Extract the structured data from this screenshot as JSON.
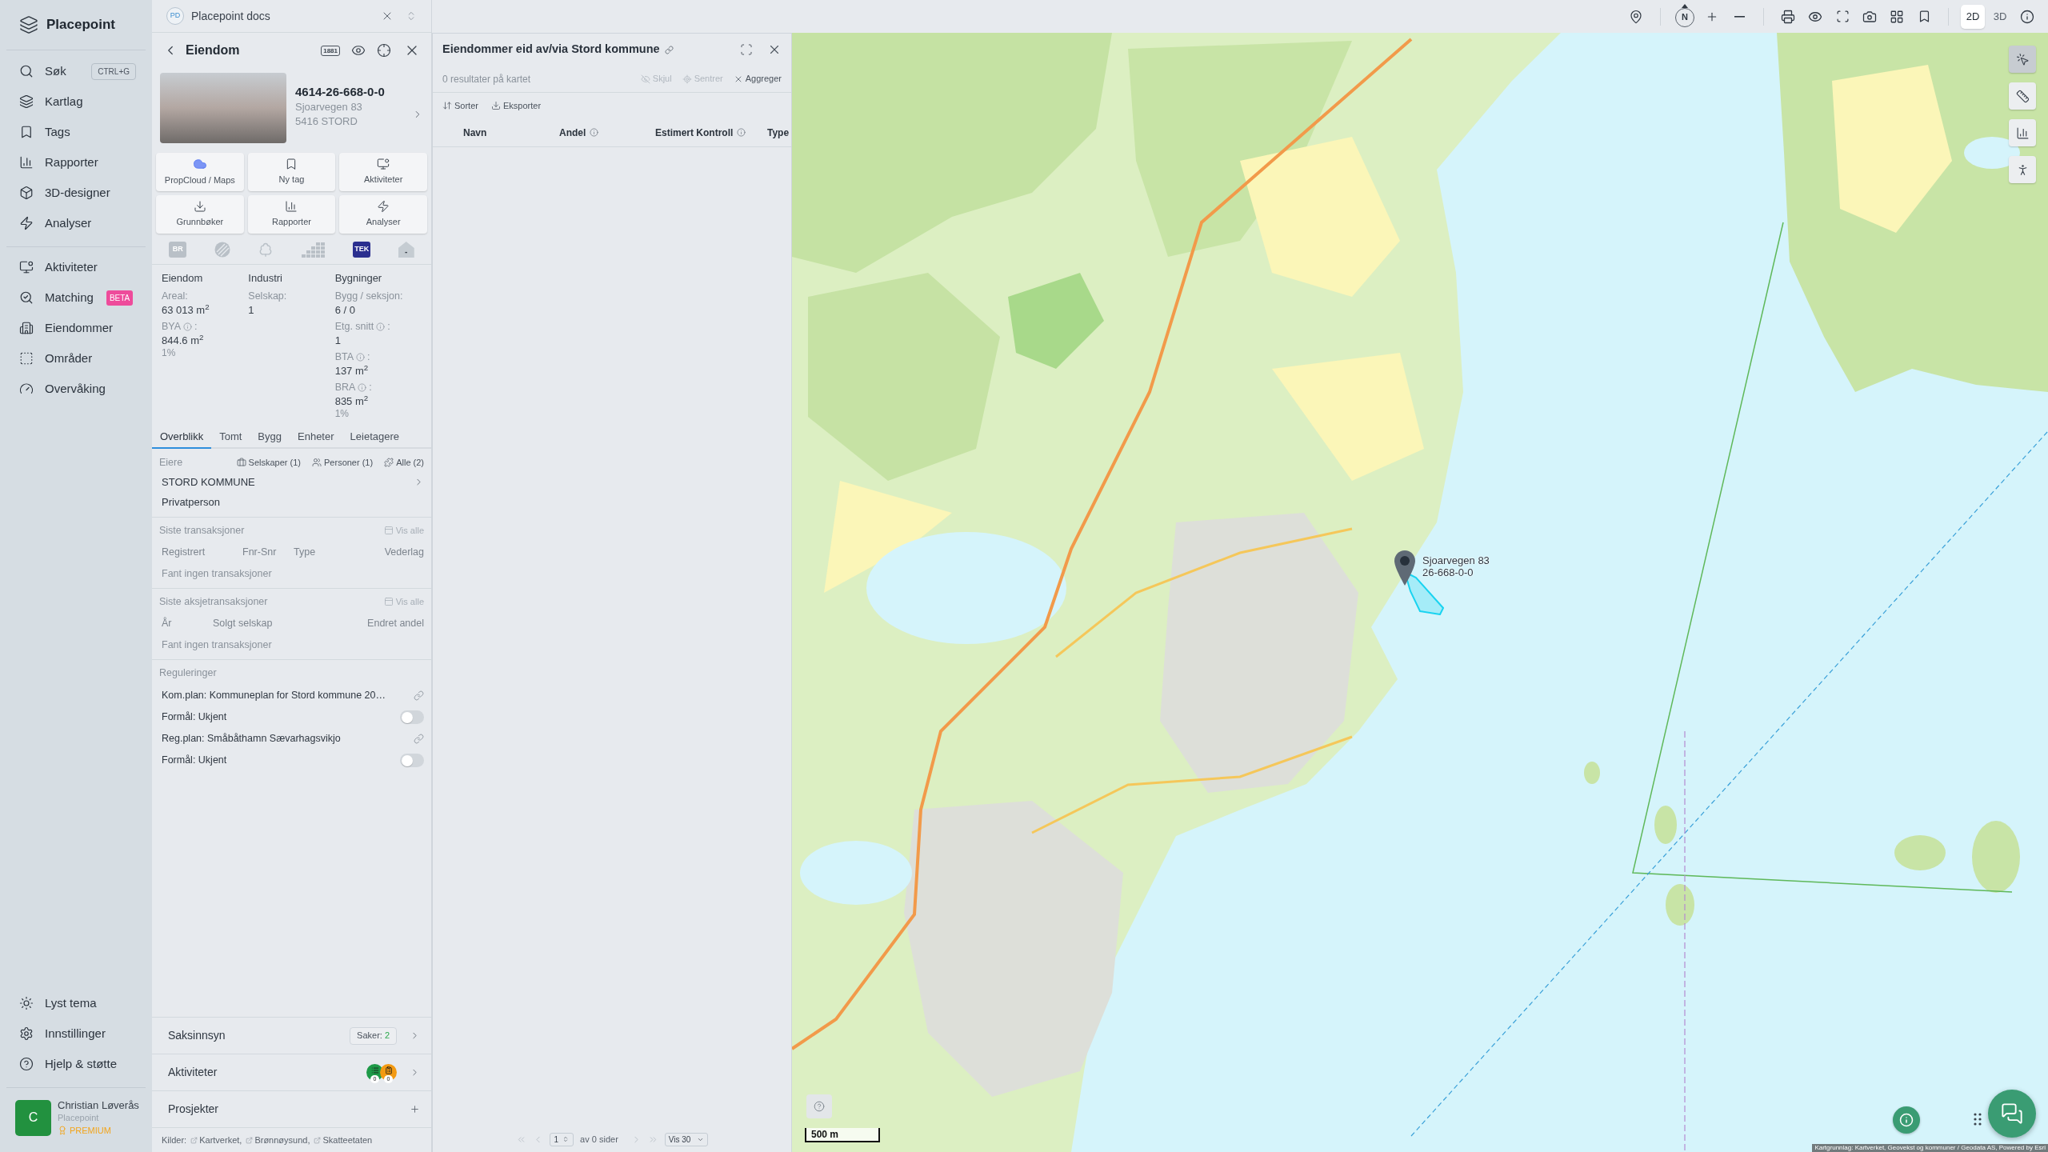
{
  "sidebar": {
    "brand": "Placepoint",
    "items": [
      {
        "label": "Søk",
        "shortcut": "CTRL+G"
      },
      {
        "label": "Kartlag"
      },
      {
        "label": "Tags"
      },
      {
        "label": "Rapporter"
      },
      {
        "label": "3D-designer"
      },
      {
        "label": "Analyser"
      }
    ],
    "items_2": [
      {
        "label": "Aktiviteter"
      },
      {
        "label": "Matching",
        "badge": "BETA"
      },
      {
        "label": "Eiendommer"
      },
      {
        "label": "Områder"
      },
      {
        "label": "Overvåking"
      }
    ],
    "footer_items": [
      {
        "label": "Lyst tema"
      },
      {
        "label": "Innstillinger"
      },
      {
        "label": "Hjelp & støtte"
      }
    ],
    "user": {
      "initial": "C",
      "name": "Christian Løverås",
      "organization": "Placepoint",
      "plan": "PREMIUM"
    }
  },
  "doc_tab": {
    "initials": "PD",
    "title": "Placepoint docs"
  },
  "property_panel": {
    "title": "Eiendom",
    "directory_badge": "1881",
    "property_id": "4614-26-668-0-0",
    "address": [
      "Sjoarvegen 83",
      "5416 STORD"
    ],
    "actions": [
      {
        "label": "PropCloud / Maps"
      },
      {
        "label": "Ny tag"
      },
      {
        "label": "Aktiviteter"
      },
      {
        "label": "Grunnbøker"
      },
      {
        "label": "Rapporter"
      },
      {
        "label": "Analyser"
      }
    ],
    "data_badges": [
      {
        "kind": "br",
        "label": "BR",
        "active": false
      },
      {
        "kind": "globe",
        "active": false
      },
      {
        "kind": "tree",
        "active": false
      },
      {
        "kind": "bars",
        "active": false
      },
      {
        "kind": "tek",
        "label": "TEK",
        "active": true
      },
      {
        "kind": "house",
        "label": "-",
        "active": false
      }
    ],
    "summary": [
      {
        "heading": "Eiendom",
        "fields": [
          {
            "label": "Areal:",
            "value": "63 013 m$^{2}$"
          },
          {
            "label": "BYA",
            "info": true,
            "label_end": ":",
            "value": "844.6 m$^{2}$",
            "share": "1%"
          }
        ]
      },
      {
        "heading": "Industri",
        "fields": [
          {
            "label": "Selskap:",
            "value": "1"
          }
        ]
      },
      {
        "heading": "Bygninger",
        "fields": [
          {
            "label": "Bygg / seksjon:",
            "value": "6 / 0"
          },
          {
            "label": "Etg. snitt",
            "info": true,
            "label_end": ":",
            "value": "1"
          },
          {
            "label": "BTA",
            "info": true,
            "label_end": ":",
            "value": "137 m$^{2}$"
          },
          {
            "label": "BRA",
            "info": true,
            "label_end": ":",
            "value": "835 m$^{2}$",
            "share": "1%"
          }
        ]
      }
    ],
    "tabs": [
      {
        "label": "Overblikk",
        "selected": true
      },
      {
        "label": "Tomt",
        "selected": false
      },
      {
        "label": "Bygg",
        "selected": false
      },
      {
        "label": "Enheter",
        "selected": false
      },
      {
        "label": "Leietagere",
        "selected": false
      }
    ],
    "owners": {
      "title": "Eiere",
      "filters": [
        {
          "label": "Selskaper (1)"
        },
        {
          "label": "Personer (1)"
        },
        {
          "label": "Alle (2)"
        }
      ],
      "rows": [
        {
          "name": "STORD KOMMUNE",
          "expandable": true
        },
        {
          "name": "Privatperson",
          "expandable": false
        }
      ]
    },
    "transactions": {
      "title": "Siste transaksjoner",
      "action": "Vis alle",
      "columns": [
        "Registrert",
        "Fnr-Snr",
        "Type",
        "Vederlag"
      ],
      "empty": "Fant ingen transaksjoner"
    },
    "share_transactions": {
      "title": "Siste aksjetransaksjoner",
      "action": "Vis alle",
      "columns": [
        "År",
        "Solgt selskap",
        "Endret andel"
      ],
      "empty": "Fant ingen transaksjoner"
    },
    "regulations": {
      "title": "Reguleringer",
      "items": [
        {
          "kind": "link",
          "text": "Kom.plan: Kommuneplan for Stord kommune 20…"
        },
        {
          "kind": "toggle",
          "text": "Formål: Ukjent",
          "on": false
        },
        {
          "kind": "link",
          "text": "Reg.plan: Småbåthamn Sævarhagsvikjo"
        },
        {
          "kind": "toggle",
          "text": "Formål: Ukjent",
          "on": false
        }
      ]
    },
    "sections": [
      {
        "kind": "cases",
        "title": "Saksinnsyn",
        "badge_label": "Saker:",
        "badge_value": "2"
      },
      {
        "kind": "activities",
        "title": "Aktiviteter",
        "counts": [
          {
            "value": "0",
            "color": "#1e9a48"
          },
          {
            "value": "0",
            "color": "#f39a12"
          }
        ]
      },
      {
        "kind": "add",
        "title": "Prosjekter"
      }
    ],
    "sources_footer": {
      "label": "Kilder:",
      "links": [
        "Kartverket,",
        "Brønnøysund,",
        "Skatteetaten"
      ]
    }
  },
  "results_panel": {
    "title": "Eiendommer eid av/via Stord kommune",
    "result_count": "0 resultater på kartet",
    "actions": [
      {
        "label": "Skjul",
        "disabled": true
      },
      {
        "label": "Sentrer",
        "disabled": true
      },
      {
        "label": "Aggreger",
        "disabled": false
      }
    ],
    "tools": [
      {
        "label": "Sorter"
      },
      {
        "label": "Eksporter"
      }
    ],
    "columns": [
      {
        "label": "Navn"
      },
      {
        "label": "Andel",
        "info": true
      },
      {
        "label": "Estimert Kontroll",
        "info": true
      },
      {
        "label": "Type"
      }
    ],
    "pagination": {
      "page": "1",
      "of_pages": "av 0 sider",
      "per_page": "Vis 30",
      "nav_disabled": true
    }
  },
  "map": {
    "compass": "N",
    "view_modes": [
      {
        "label": "2D",
        "selected": true
      },
      {
        "label": "3D",
        "selected": false
      }
    ],
    "side_tools": [
      {
        "selected": true
      },
      {
        "selected": false
      },
      {
        "selected": false
      },
      {
        "selected": false
      }
    ],
    "marker": {
      "title": "Sjoarvegen 83",
      "subtitle": "26-668-0-0"
    },
    "scale": "500 m",
    "attribution": "Kartgrunnlag: Kartverket, Geovekst og kommuner / Geodata AS, Powered by Esri"
  }
}
